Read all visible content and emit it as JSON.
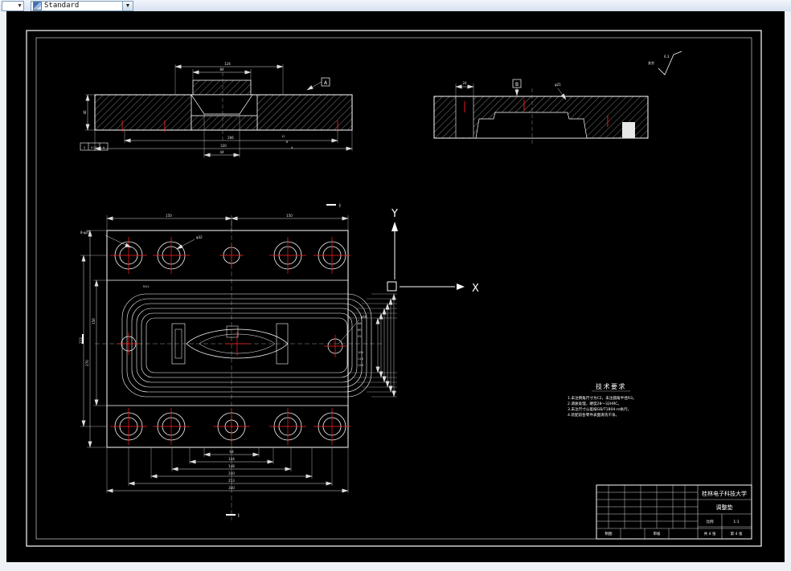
{
  "toolbar": {
    "style_value": "Standard"
  },
  "axes": {
    "x": "X",
    "y": "Y"
  },
  "roughness": {
    "prefix": "其余",
    "value": "6.3"
  },
  "tech": {
    "title": "技术要求",
    "lines": [
      "1.未注倒角尺寸为C2，未注圆角半径R3。",
      "2.调质处理，硬度28～32HRC。",
      "3.未注尺寸公差按GB/T1804-m执行。",
      "4.装配前各零件表面清洗干净。"
    ]
  },
  "title_block": {
    "university": "桂林电子科技大学",
    "part_name": "调整垫",
    "scale_label": "比例",
    "scale_value": "1:1",
    "sheet_total": "共 4 张",
    "sheet_no": "第 4 张",
    "draw_label": "制图",
    "check_label": "审核"
  },
  "marks": {
    "section": "Ⅰ",
    "datum_a": "A",
    "datum_b": "B",
    "gdt_sym": "∥",
    "gdt_val": "0.02",
    "gdt_ref": "A"
  },
  "dims": {
    "sec1": {
      "boss": "84",
      "upper": "124",
      "left": "40",
      "bottom1": "266",
      "bottom2": "320",
      "cavity": "44",
      "stack": [
        "12",
        "8",
        "4"
      ]
    },
    "sec2": {
      "slot": "24",
      "lead": "φ25"
    },
    "plan": {
      "top": [
        "150",
        "150"
      ],
      "leader1": "8-φ25",
      "leader2": "φ32",
      "leader3": "φ16",
      "thread": "M12",
      "bottom": [
        "68",
        "104",
        "148",
        "200",
        "253",
        "300"
      ],
      "left": [
        "213",
        "270",
        "156"
      ],
      "right": [
        "68",
        "80",
        "92",
        "104",
        "116",
        "128"
      ]
    }
  }
}
